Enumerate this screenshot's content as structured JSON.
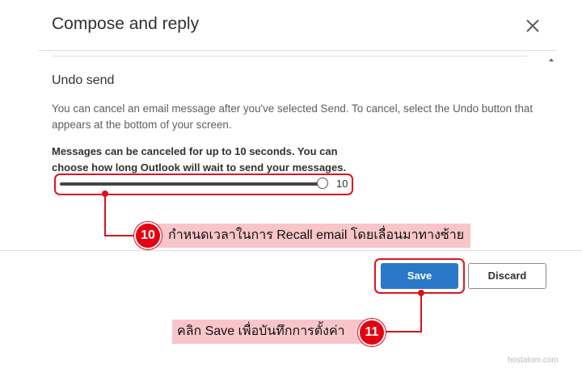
{
  "dialog": {
    "title": "Compose and reply",
    "close_icon": "close-icon"
  },
  "undo_send": {
    "heading": "Undo send",
    "description": "You can cancel an email message after you've selected Send. To cancel, select the Undo button that appears at the bottom of your screen.",
    "slider_label": "Messages can be canceled for up to 10 seconds. You can choose how long Outlook will wait to send your messages.",
    "slider_value": "10",
    "slider_level": 1.0
  },
  "buttons": {
    "save": "Save",
    "discard": "Discard"
  },
  "annotations": {
    "step10_number": "10",
    "step10_text": "กำหนดเวลาในการ Recall email โดยเลื่อนมาทางซ้าย",
    "step11_number": "11",
    "step11_text": "คลิก Save เพื่อบันทึกการตั้งค่า"
  },
  "watermark": "hostatom.com",
  "colors": {
    "accent": "#2a78c8",
    "annotation_red": "#e40012",
    "annotation_pink": "#f8c5c9"
  }
}
